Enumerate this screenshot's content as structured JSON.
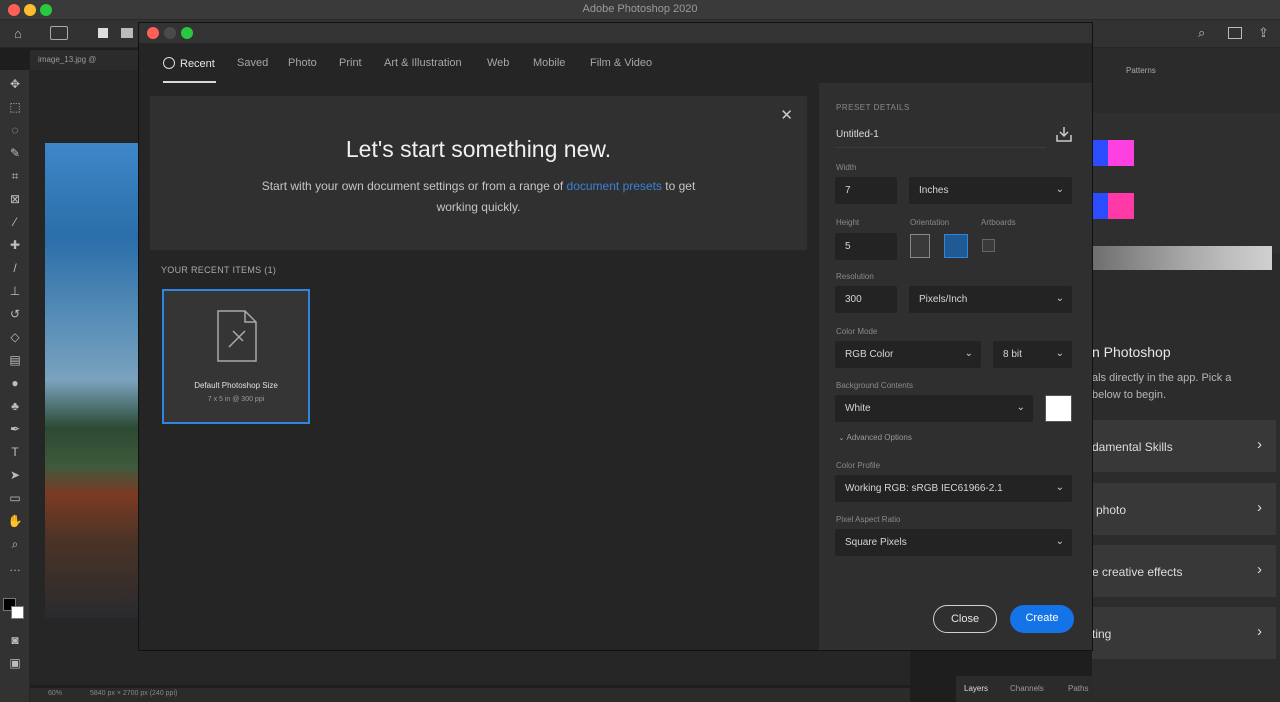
{
  "app": {
    "window_title": "Adobe Photoshop 2020"
  },
  "document_tab": {
    "label": "image_13.jpg @"
  },
  "statusbar": {
    "zoom": "60%",
    "doc_info": "5840 px × 2700 px (240 ppi)"
  },
  "right_panel": {
    "tab_patterns": "Patterns",
    "learn_title": "n Photoshop",
    "learn_desc": "als directly in the app. Pick a below to begin.",
    "cards": [
      "damental Skills",
      "photo",
      "e creative effects",
      "ting"
    ],
    "bottom_tabs": [
      "Layers",
      "Channels",
      "Paths"
    ],
    "swatch_colors": [
      "#2b4cff",
      "#ff40e0",
      "#2b4cff",
      "#ff3aa6"
    ]
  },
  "dialog": {
    "tabs": [
      "Recent",
      "Saved",
      "Photo",
      "Print",
      "Art & Illustration",
      "Web",
      "Mobile",
      "Film & Video"
    ],
    "hero": {
      "title": "Let's start something new.",
      "text_before": "Start with your own document settings or from a range of ",
      "link": "document presets",
      "text_after": " to get working quickly."
    },
    "recent_label": "YOUR RECENT ITEMS",
    "recent_count": "(1)",
    "recent_item": {
      "name": "Default Photoshop Size",
      "info": "7 x 5 in @ 300 ppi"
    },
    "preset": {
      "section_label": "PRESET DETAILS",
      "name": "Untitled-1",
      "width_label": "Width",
      "width": "7",
      "width_unit": "Inches",
      "height_label": "Height",
      "height": "5",
      "orientation_label": "Orientation",
      "artboards_label": "Artboards",
      "resolution_label": "Resolution",
      "resolution": "300",
      "resolution_unit": "Pixels/Inch",
      "color_mode_label": "Color Mode",
      "color_mode": "RGB Color",
      "bit_depth": "8 bit",
      "bg_label": "Background Contents",
      "bg": "White",
      "advanced": "Advanced Options",
      "profile_label": "Color Profile",
      "profile": "Working RGB: sRGB IEC61966-2.1",
      "par_label": "Pixel Aspect Ratio",
      "par": "Square Pixels"
    },
    "buttons": {
      "close": "Close",
      "create": "Create"
    }
  }
}
